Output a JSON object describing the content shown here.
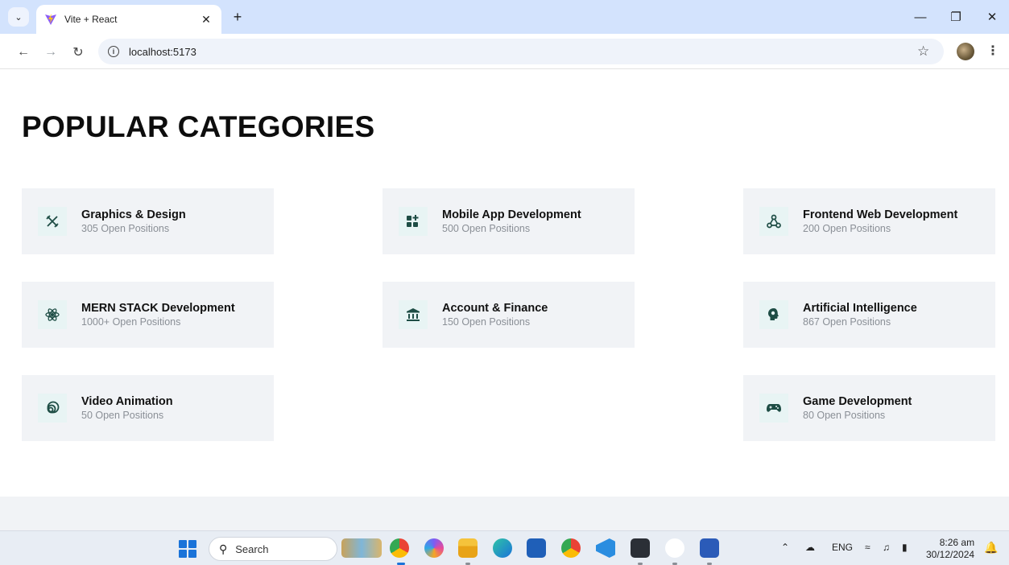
{
  "browser": {
    "tab_title": "Vite + React",
    "url": "localhost:5173"
  },
  "page": {
    "heading": "POPULAR CATEGORIES",
    "categories": [
      {
        "name": "Graphics & Design",
        "count": "305 Open Positions",
        "icon": "tools-icon"
      },
      {
        "name": "Mobile App Development",
        "count": "500 Open Positions",
        "icon": "apps-icon"
      },
      {
        "name": "Frontend Web Development",
        "count": "200 Open Positions",
        "icon": "webhook-icon"
      },
      {
        "name": "MERN STACK Development",
        "count": "1000+ Open Positions",
        "icon": "react-icon"
      },
      {
        "name": "Account & Finance",
        "count": "150 Open Positions",
        "icon": "bank-icon"
      },
      {
        "name": "Artificial Intelligence",
        "count": "867 Open Positions",
        "icon": "ai-brain-icon"
      },
      {
        "name": "Video Animation",
        "count": "50 Open Positions",
        "icon": "animation-icon"
      },
      {
        "name": "Game Development",
        "count": "80 Open Positions",
        "icon": "gamepad-icon"
      }
    ],
    "icon_color": "#1e4d45"
  },
  "taskbar": {
    "search_label": "Search",
    "lang": "ENG",
    "time": "8:26 am",
    "date": "30/12/2024"
  }
}
